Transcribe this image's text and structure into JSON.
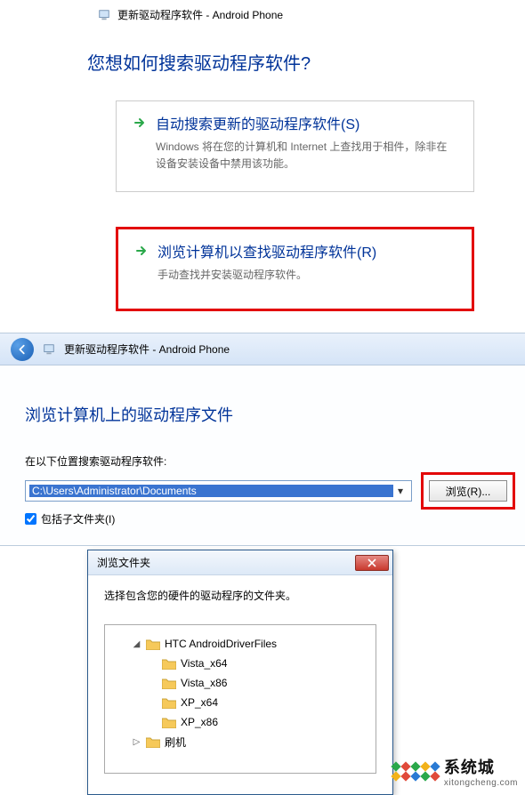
{
  "wizard": {
    "header": "更新驱动程序软件 - Android Phone",
    "question": "您想如何搜索驱动程序软件?",
    "option_auto": {
      "title": "自动搜索更新的驱动程序软件(S)",
      "desc": "Windows 将在您的计算机和 Internet 上查找用于相件，除非在设备安装设备中禁用该功能。"
    },
    "option_browse": {
      "title": "浏览计算机以查找驱动程序软件(R)",
      "desc": "手动查找并安装驱动程序软件。"
    }
  },
  "browse_page": {
    "header": "更新驱动程序软件 - Android Phone",
    "title": "浏览计算机上的驱动程序文件",
    "search_label": "在以下位置搜索驱动程序软件:",
    "path": "C:\\Users\\Administrator\\Documents",
    "browse_btn": "浏览(R)...",
    "include_sub": "包括子文件夹(I)"
  },
  "folder_dialog": {
    "title": "浏览文件夹",
    "message": "选择包含您的硬件的驱动程序的文件夹。",
    "tree": {
      "root": "HTC AndroidDriverFiles",
      "children": [
        "Vista_x64",
        "Vista_x86",
        "XP_x64",
        "XP_x86"
      ],
      "sibling": "刷机"
    }
  },
  "watermark": {
    "name": "系统城",
    "url": "xitongcheng.com"
  },
  "colors": {
    "d": [
      "#2aa84a",
      "#e04a3a",
      "#2aa84a",
      "#f2b21a",
      "#2a7ad4",
      "#f2b21a",
      "#e04a3a",
      "#2a7ad4",
      "#2aa84a",
      "#e04a3a"
    ]
  }
}
